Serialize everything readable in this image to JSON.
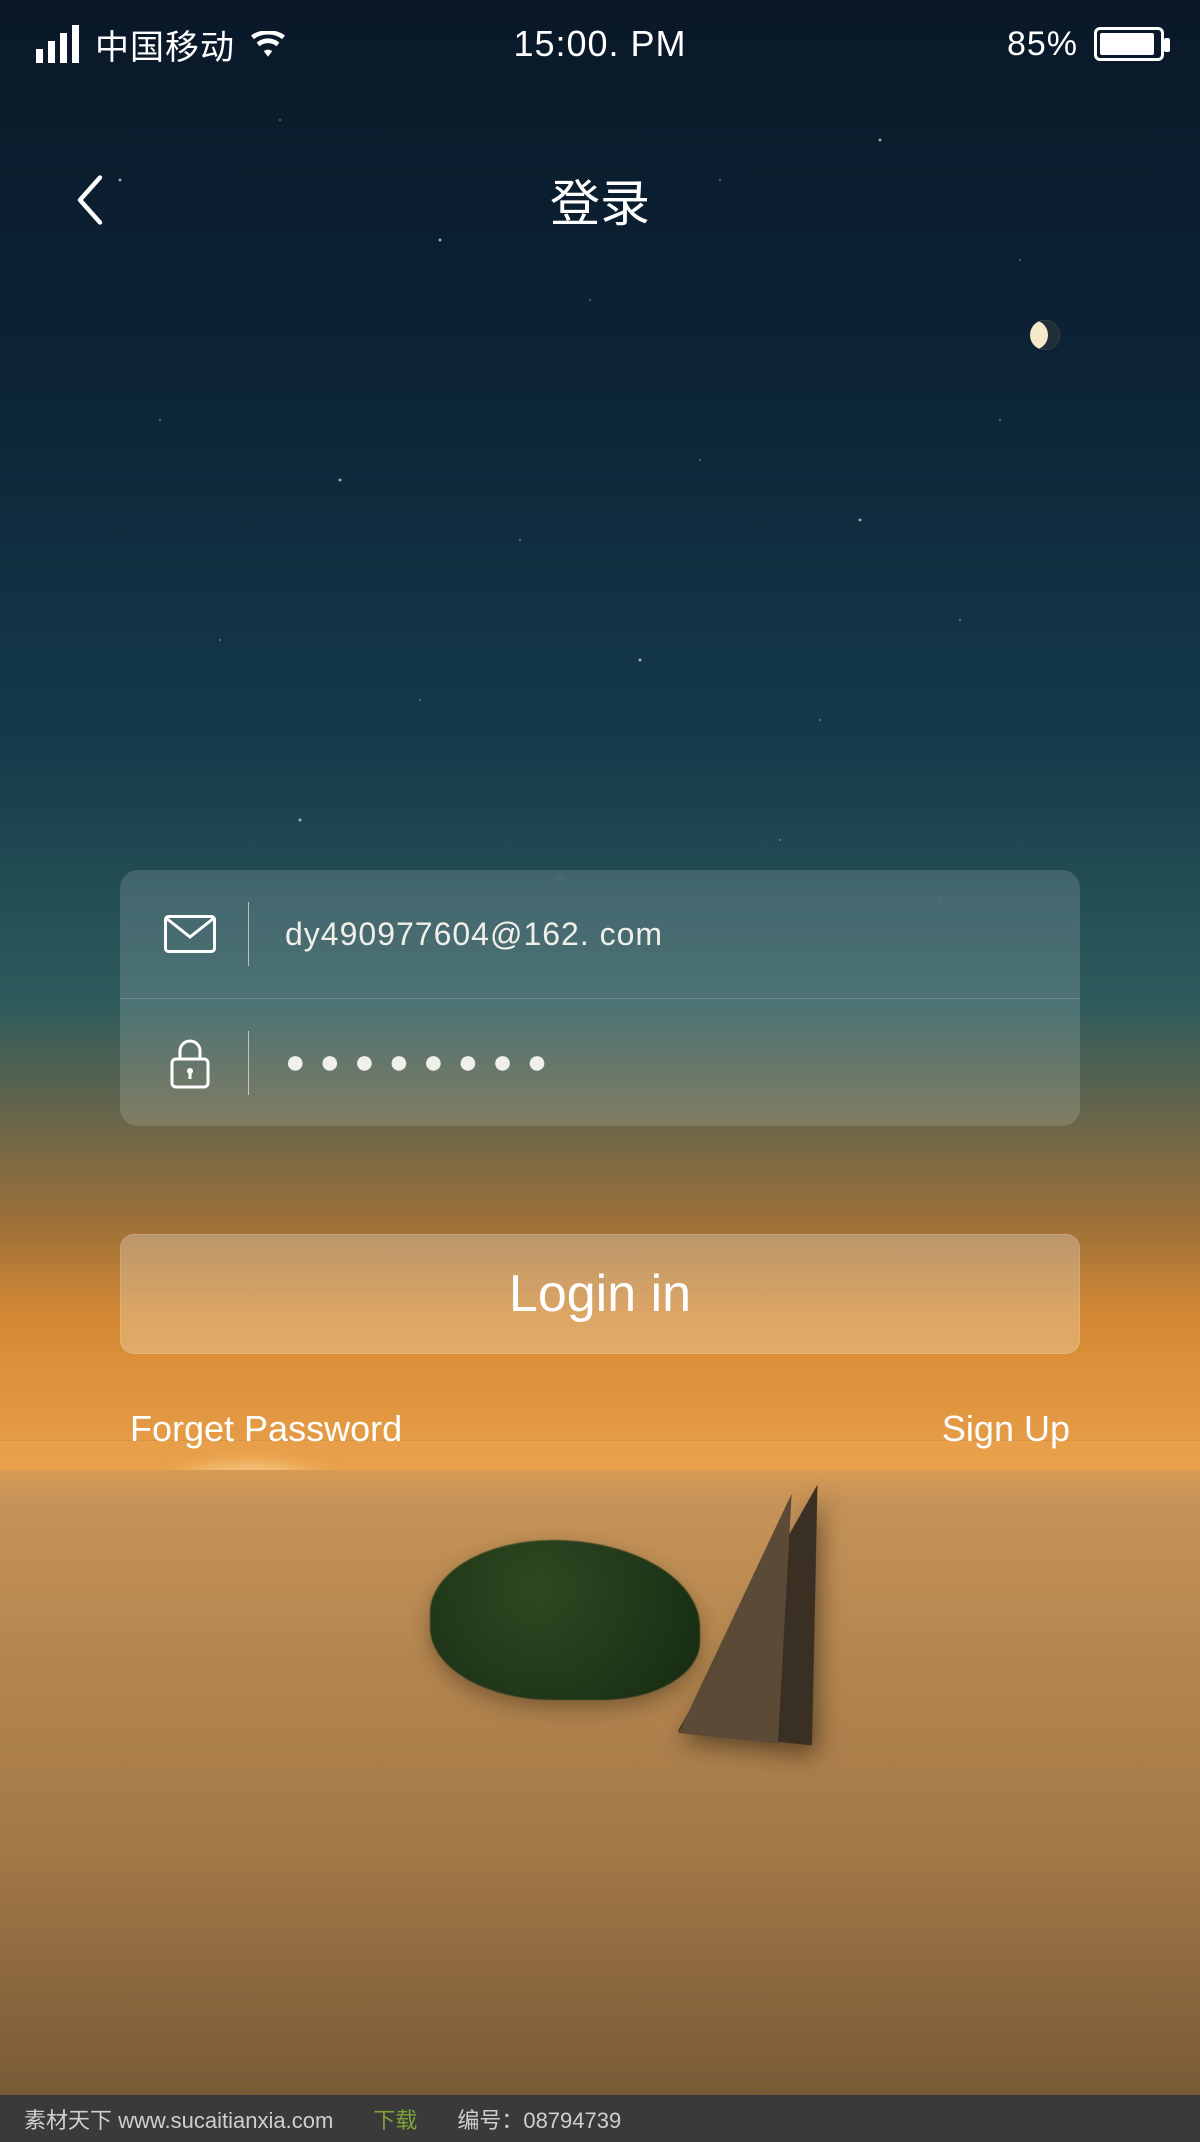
{
  "statusbar": {
    "carrier": "中国移动",
    "time": "15:00. PM",
    "battery_pct": "85%"
  },
  "header": {
    "title": "登录"
  },
  "form": {
    "email_value": "dy490977604@162. com",
    "password_mask": "●●●●●●●●",
    "login_label": "Login in",
    "forgot_label": "Forget Password",
    "signup_label": "Sign Up"
  },
  "footer": {
    "left": "素材天下 www.sucaitianxia.com",
    "download": "下载",
    "meta": "编号：08794739"
  },
  "icons": {
    "signal": "signal-icon",
    "wifi": "wifi-icon",
    "battery": "battery-icon",
    "back": "chevron-left-icon",
    "mail": "mail-icon",
    "lock": "lock-icon"
  }
}
